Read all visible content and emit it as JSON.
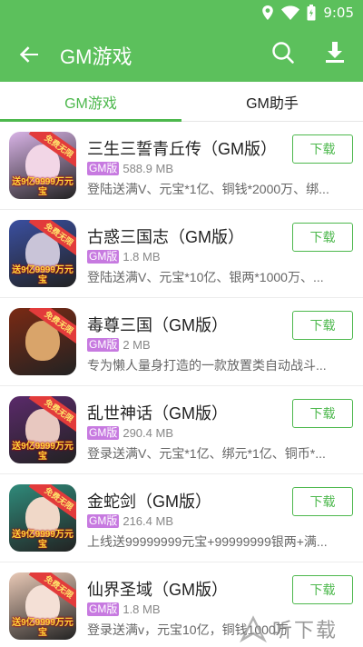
{
  "status_bar": {
    "time": "9:05"
  },
  "app_bar": {
    "title": "GM游戏",
    "back_icon": "arrow-left-icon",
    "search_icon": "search-icon",
    "download_icon": "download-icon"
  },
  "tabs": [
    {
      "label": "GM游戏",
      "active": true
    },
    {
      "label": "GM助手",
      "active": false
    }
  ],
  "games": [
    {
      "name": "三生三誓青丘传（GM版）",
      "tag": "GM版",
      "size": "588.9 MB",
      "desc": "登陆送满V、元宝*1亿、铜钱*2000万、绑...",
      "button": "下载",
      "icon_ribbon": "免费无限",
      "icon_text": "送9亿9999万元宝",
      "icon_bg": "#d8b3e6",
      "icon_face": "#f2d6e6"
    },
    {
      "name": "古惑三国志（GM版）",
      "tag": "GM版",
      "size": "1.8 MB",
      "desc": "登陆送满V、元宝*10亿、银两*1000万、...",
      "button": "下载",
      "icon_ribbon": "免费无限",
      "icon_text": "送9亿9999万元宝",
      "icon_bg": "#3a4fa0",
      "icon_face": "#c9c4d8"
    },
    {
      "name": "毒尊三国（GM版）",
      "tag": "GM版",
      "size": "2 MB",
      "desc": "专为懒人量身打造的一款放置类自动战斗...",
      "button": "下载",
      "icon_ribbon": "免费无限",
      "icon_text": "",
      "icon_bg": "#7a2a14",
      "icon_face": "#d9a46a"
    },
    {
      "name": "乱世神话（GM版）",
      "tag": "GM版",
      "size": "290.4 MB",
      "desc": "登录送满V、元宝*1亿、绑元*1亿、铜币*...",
      "button": "下载",
      "icon_ribbon": "免费无限",
      "icon_text": "送9亿9999万元宝",
      "icon_bg": "#5a2a6a",
      "icon_face": "#e8c8c0"
    },
    {
      "name": "金蛇剑（GM版）",
      "tag": "GM版",
      "size": "216.4 MB",
      "desc": "上线送99999999元宝+99999999银两+满...",
      "button": "下载",
      "icon_ribbon": "免费无限",
      "icon_text": "送9亿9999万元宝",
      "icon_bg": "#2f8a7a",
      "icon_face": "#f0d8c8"
    },
    {
      "name": "仙界圣域（GM版）",
      "tag": "GM版",
      "size": "1.8 MB",
      "desc": "登录送满v，元宝10亿，铜钱1000万",
      "button": "下载",
      "icon_ribbon": "免费无限",
      "icon_text": "送9亿9999万元宝",
      "icon_bg": "#e9c9b6",
      "icon_face": "#f4e0d6"
    }
  ],
  "watermark": {
    "text": "听下载"
  },
  "colors": {
    "primary": "#5cc05c",
    "accent": "#4db84d",
    "tag": "#c77ae0"
  }
}
